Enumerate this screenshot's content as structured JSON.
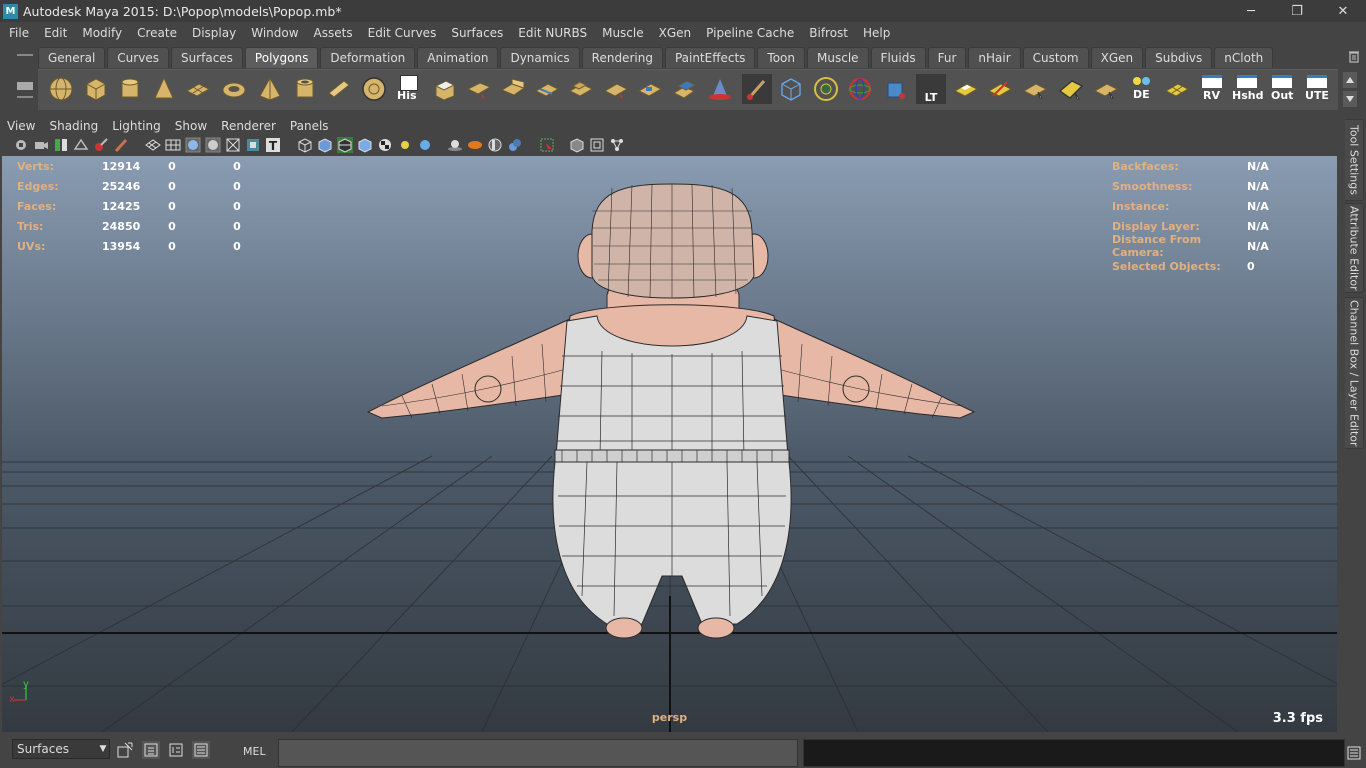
{
  "window": {
    "title": "Autodesk Maya 2015: D:\\Popop\\models\\Popop.mb*",
    "app_icon_letter": "M",
    "controls": {
      "minimize": "─",
      "restore": "❐",
      "close": "✕"
    }
  },
  "menubar": {
    "items": [
      "File",
      "Edit",
      "Modify",
      "Create",
      "Display",
      "Window",
      "Assets",
      "Edit Curves",
      "Surfaces",
      "Edit NURBS",
      "Muscle",
      "XGen",
      "Pipeline Cache",
      "Bifrost",
      "Help"
    ]
  },
  "shelf": {
    "tabs": [
      "General",
      "Curves",
      "Surfaces",
      "Polygons",
      "Deformation",
      "Animation",
      "Dynamics",
      "Rendering",
      "PaintEffects",
      "Toon",
      "Muscle",
      "Fluids",
      "Fur",
      "nHair",
      "Custom",
      "XGen",
      "Subdivs",
      "nCloth"
    ],
    "active_tab": "Polygons",
    "text_icons": {
      "his": "His",
      "lt": "LT",
      "de": "DE",
      "rv": "RV",
      "hshd": "Hshd",
      "out": "Out",
      "ute": "UTE"
    }
  },
  "panel": {
    "menu": [
      "View",
      "Shading",
      "Lighting",
      "Show",
      "Renderer",
      "Panels"
    ]
  },
  "hud": {
    "left": [
      {
        "label": "Verts:",
        "v1": "12914",
        "v2": "0",
        "v3": "0"
      },
      {
        "label": "Edges:",
        "v1": "25246",
        "v2": "0",
        "v3": "0"
      },
      {
        "label": "Faces:",
        "v1": "12425",
        "v2": "0",
        "v3": "0"
      },
      {
        "label": "Tris:",
        "v1": "24850",
        "v2": "0",
        "v3": "0"
      },
      {
        "label": "UVs:",
        "v1": "13954",
        "v2": "0",
        "v3": "0"
      }
    ],
    "right": [
      {
        "label": "Backfaces:",
        "value": "N/A"
      },
      {
        "label": "Smoothness:",
        "value": "N/A"
      },
      {
        "label": "Instance:",
        "value": "N/A"
      },
      {
        "label": "Display Layer:",
        "value": "N/A"
      },
      {
        "label": "Distance From Camera:",
        "value": "N/A"
      },
      {
        "label": "Selected Objects:",
        "value": "0"
      }
    ],
    "camera": "persp",
    "fps": "3.3 fps",
    "axis_y": "y",
    "axis_x": "x"
  },
  "side_tabs": [
    "Tool Settings",
    "Attribute Editor",
    "Channel Box / Layer Editor"
  ],
  "command_line": {
    "menu_set": "Surfaces",
    "mel_label": "MEL"
  },
  "colors": {
    "hud_label": "#e0b080",
    "skin": "#e7b8a6",
    "cloth": "#d8d8d8",
    "viewport_top": "#8a9cb2",
    "viewport_bottom": "#333a41"
  }
}
